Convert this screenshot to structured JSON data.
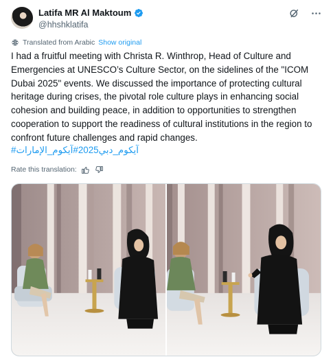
{
  "author": {
    "name": "Latifa MR Al Maktoum",
    "handle": "@hhshklatifa",
    "verified": true
  },
  "translation": {
    "notice": "Translated from Arabic",
    "show_original": "Show original",
    "rate_label": "Rate this translation:"
  },
  "tweet": {
    "text": "I had a fruitful meeting with Christa R. Winthrop, Head of Culture and Emergencies at UNESCO’s Culture Sector, on the sidelines of the \"ICOM Dubai 2025\" events. We discussed the importance of protecting cultural heritage during crises, the pivotal role culture plays in enhancing social cohesion and building peace, in addition to opportunities to strengthen cooperation to support the readiness of cultural institutions in the region to confront future challenges and rapid changes.",
    "hashtags": [
      "#آيكوم_الإمارات",
      "#آيكوم_دبي2025"
    ]
  },
  "icons": {
    "verified": "verified-badge-icon",
    "grok": "grok-icon",
    "more": "more-icon",
    "translate": "translate-icon",
    "thumbs_up": "thumbs-up-icon",
    "thumbs_down": "thumbs-down-icon"
  },
  "colors": {
    "accent": "#1d9bf0",
    "secondary_text": "#536471",
    "primary_text": "#0f1419"
  }
}
